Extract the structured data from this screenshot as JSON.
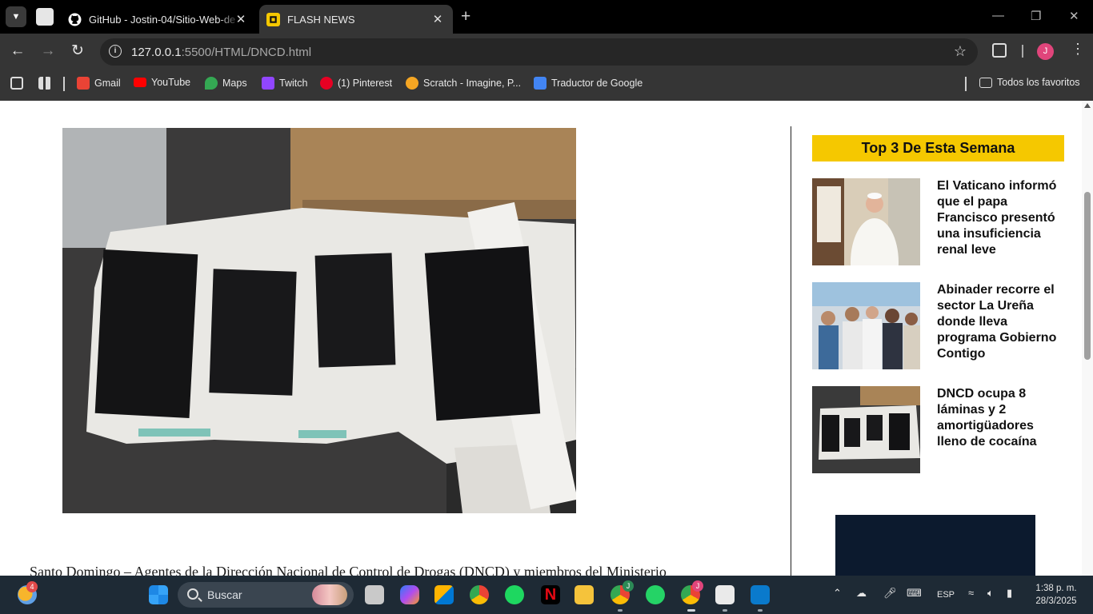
{
  "browser": {
    "tabs": [
      {
        "title": "GitHub - Jostin-04/Sitio-Web-de",
        "favicon": "github-icon",
        "active": false
      },
      {
        "title": "FLASH NEWS",
        "favicon": "flash-news-icon",
        "active": true
      }
    ],
    "new_tab": "+",
    "url": {
      "host": "127.0.0.1",
      "path": ":5500/HTML/DNCD.html"
    },
    "profile_initial": "J",
    "bookmarks": [
      {
        "label": "Gmail",
        "icon": "gmail-icon",
        "color": "#ea4335"
      },
      {
        "label": "YouTube",
        "icon": "youtube-icon",
        "color": "#ff0000"
      },
      {
        "label": "Maps",
        "icon": "maps-icon",
        "color": "#34a853"
      },
      {
        "label": "Twitch",
        "icon": "twitch-icon",
        "color": "#9146ff"
      },
      {
        "label": "(1) Pinterest",
        "icon": "pinterest-icon",
        "color": "#e60023"
      },
      {
        "label": "Scratch - Imagine, P...",
        "icon": "scratch-icon",
        "color": "#f5a623"
      },
      {
        "label": "Traductor de Google",
        "icon": "google-translate-icon",
        "color": "#4285f4"
      }
    ],
    "all_bookmarks": "Todos los favoritos"
  },
  "article": {
    "first_line": "Santo Domingo – Agentes de la Dirección Nacional de Control de Drogas (DNCD) y miembros del Ministerio"
  },
  "sidebar": {
    "heading": "Top 3 De Esta Semana",
    "accent": "#f5c800",
    "items": [
      {
        "title": "El Vaticano informó que el papa Francisco presentó una insuficiencia renal leve"
      },
      {
        "title": "Abinader recorre el sector La Ureña donde lleva programa Gobierno Contigo"
      },
      {
        "title": "DNCD ocupa 8 láminas y 2 amortigüadores lleno de cocaína"
      }
    ]
  },
  "taskbar": {
    "weather_badge": "4",
    "search_label": "Buscar",
    "language": "ESP",
    "time": "1:38 p. m.",
    "date": "28/3/2025",
    "profile_badges": [
      "J",
      "J"
    ]
  }
}
